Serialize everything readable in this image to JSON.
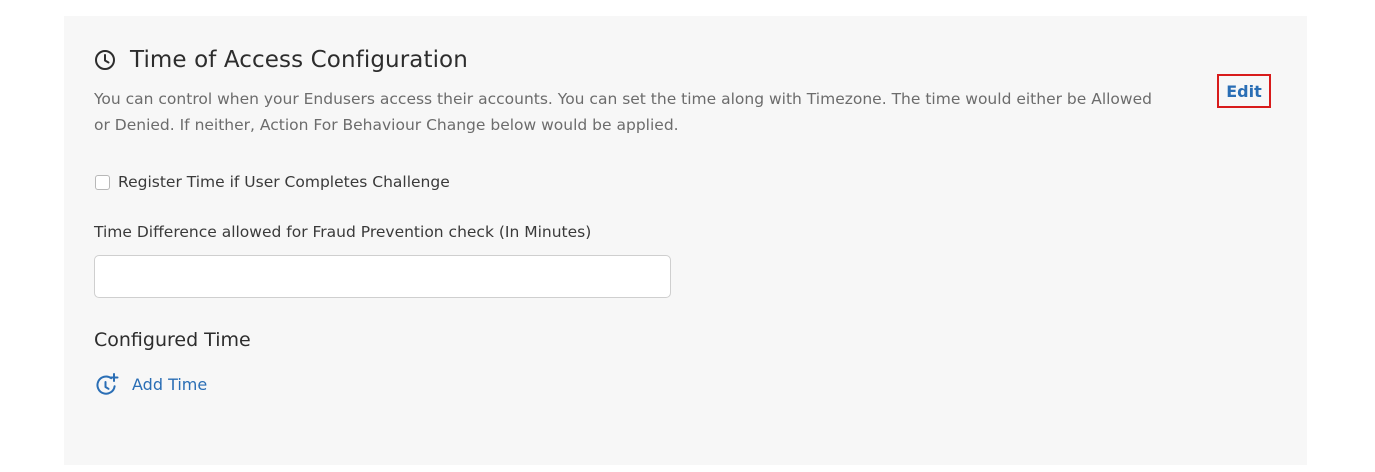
{
  "section": {
    "icon": "clock-icon",
    "title": "Time of Access Configuration",
    "description": "You can control when your Endusers access their accounts. You can set the time along with Timezone. The time would either be Allowed or Denied. If neither, Action For Behaviour Change below would be applied.",
    "edit_label": "Edit"
  },
  "register_time": {
    "label": "Register Time if User Completes Challenge",
    "checked": false
  },
  "fraud_prevention": {
    "label": "Time Difference allowed for Fraud Prevention check (In Minutes)",
    "value": "",
    "placeholder": ""
  },
  "configured_time": {
    "heading": "Configured Time",
    "add_label": "Add Time",
    "add_icon": "add-time-icon"
  },
  "colors": {
    "panel_background": "#f7f7f7",
    "link_blue": "#2a6eb5",
    "edit_highlight_border": "#d81b1b"
  }
}
